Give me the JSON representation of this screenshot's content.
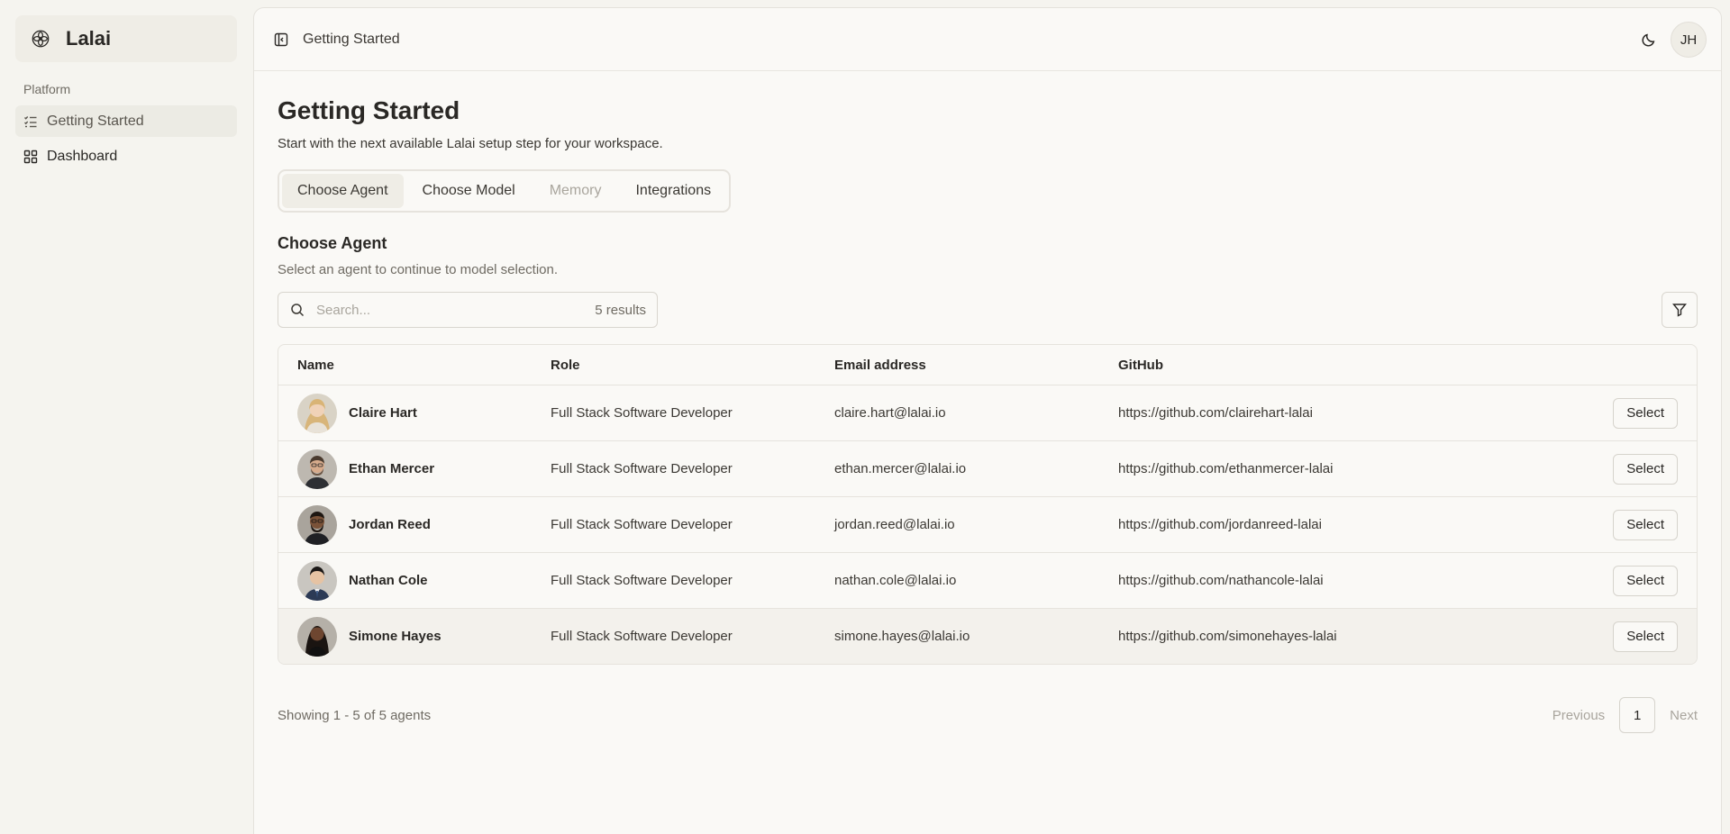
{
  "sidebar": {
    "brand": "Lalai",
    "section_label": "Platform",
    "items": [
      {
        "label": "Getting Started",
        "icon": "list-checks-icon"
      },
      {
        "label": "Dashboard",
        "icon": "grid-icon"
      }
    ]
  },
  "topbar": {
    "breadcrumb": "Getting Started",
    "avatar_initials": "JH"
  },
  "page": {
    "title": "Getting Started",
    "subtitle": "Start with the next available Lalai setup step for your workspace."
  },
  "tabs": [
    {
      "label": "Choose Agent",
      "state": "active"
    },
    {
      "label": "Choose Model",
      "state": "default"
    },
    {
      "label": "Memory",
      "state": "disabled"
    },
    {
      "label": "Integrations",
      "state": "default"
    }
  ],
  "section": {
    "title": "Choose Agent",
    "subtitle": "Select an agent to continue to model selection."
  },
  "search": {
    "placeholder": "Search...",
    "value": "",
    "results": "5 results"
  },
  "table": {
    "headers": {
      "name": "Name",
      "role": "Role",
      "email": "Email address",
      "github": "GitHub"
    },
    "rows": [
      {
        "name": "Claire Hart",
        "role": "Full Stack Software Developer",
        "email": "claire.hart@lalai.io",
        "github": "https://github.com/clairehart-lalai",
        "action": "Select"
      },
      {
        "name": "Ethan Mercer",
        "role": "Full Stack Software Developer",
        "email": "ethan.mercer@lalai.io",
        "github": "https://github.com/ethanmercer-lalai",
        "action": "Select"
      },
      {
        "name": "Jordan Reed",
        "role": "Full Stack Software Developer",
        "email": "jordan.reed@lalai.io",
        "github": "https://github.com/jordanreed-lalai",
        "action": "Select"
      },
      {
        "name": "Nathan Cole",
        "role": "Full Stack Software Developer",
        "email": "nathan.cole@lalai.io",
        "github": "https://github.com/nathancole-lalai",
        "action": "Select"
      },
      {
        "name": "Simone Hayes",
        "role": "Full Stack Software Developer",
        "email": "simone.hayes@lalai.io",
        "github": "https://github.com/simonehayes-lalai",
        "action": "Select"
      }
    ]
  },
  "pagination": {
    "summary": "Showing 1 - 5 of 5 agents",
    "previous": "Previous",
    "page": "1",
    "next": "Next"
  },
  "colors": {
    "background": "#f5f4ef",
    "panel": "#faf9f6",
    "text": "#2a2825",
    "muted": "#6f6b63",
    "border": "#e6e3dd"
  }
}
